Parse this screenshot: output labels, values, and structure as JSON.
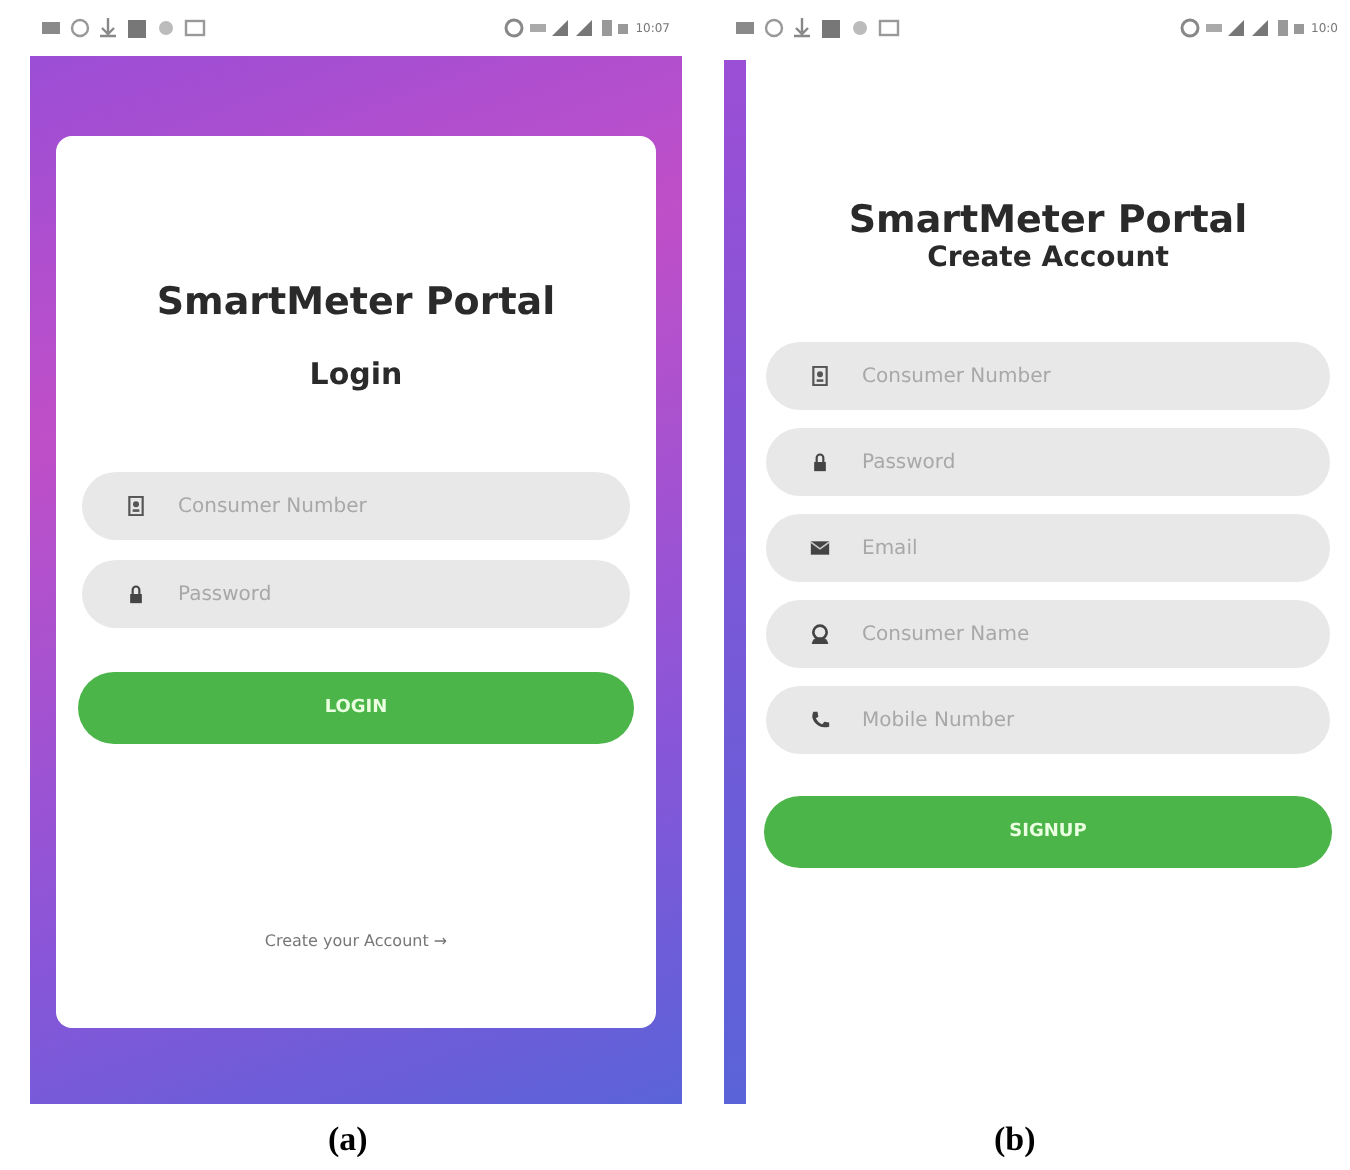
{
  "screens": [
    {
      "kind": "login",
      "status_bar": {
        "time": "10:07"
      },
      "title": "SmartMeter Portal",
      "subtitle": "Login",
      "fields": [
        {
          "kind": "id",
          "placeholder": "Consumer Number"
        },
        {
          "kind": "lock",
          "placeholder": "Password"
        }
      ],
      "button": "LOGIN",
      "link": {
        "label": "Create your Account",
        "arrow": "→"
      },
      "caption": "(a)"
    },
    {
      "kind": "signup",
      "status_bar": {
        "time": "10:0"
      },
      "title": "SmartMeter Portal",
      "subtitle": "Create Account",
      "fields": [
        {
          "kind": "id",
          "placeholder": "Consumer Number"
        },
        {
          "kind": "lock",
          "placeholder": "Password"
        },
        {
          "kind": "mail",
          "placeholder": "Email"
        },
        {
          "kind": "person",
          "placeholder": "Consumer Name"
        },
        {
          "kind": "phone",
          "placeholder": "Mobile Number"
        }
      ],
      "button": "SIGNUP",
      "caption": "(b)"
    }
  ]
}
